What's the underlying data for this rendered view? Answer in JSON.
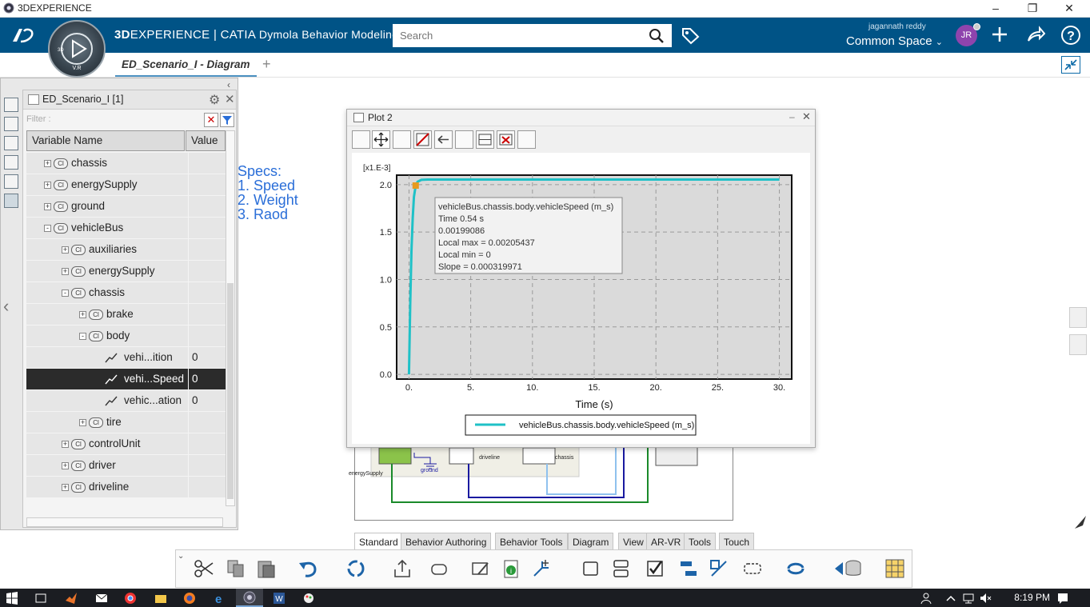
{
  "window": {
    "title": "3DEXPERIENCE"
  },
  "header": {
    "brand_bold": "3D",
    "brand_rest": "EXPERIENCE | CATIA",
    "app_name": "Dymola Behavior Modeling",
    "search_placeholder": "Search",
    "user_name": "jagannath reddy",
    "space": "Common Space",
    "avatar_initials": "JR",
    "compass_label": "V.R"
  },
  "tabs": [
    {
      "label": "ED_Scenario_I - Diagram"
    }
  ],
  "tab_add": "+",
  "variable_browser": {
    "title": "ED_Scenario_I [1]",
    "filter_placeholder": "Filter :",
    "col_name": "Variable Name",
    "col_value": "Value",
    "rows": [
      {
        "label": "chassis",
        "type": "class",
        "expand": "+",
        "value": ""
      },
      {
        "label": "energySupply",
        "type": "class",
        "expand": "+",
        "value": ""
      },
      {
        "label": "ground",
        "type": "class",
        "expand": "+",
        "value": ""
      },
      {
        "label": "vehicleBus",
        "type": "class",
        "expand": "-",
        "value": ""
      },
      {
        "label": "auxiliaries",
        "type": "class",
        "expand": "+",
        "value": ""
      },
      {
        "label": "energySupply",
        "type": "class",
        "expand": "+",
        "value": ""
      },
      {
        "label": "chassis",
        "type": "class",
        "expand": "-",
        "value": ""
      },
      {
        "label": "brake",
        "type": "class",
        "expand": "+",
        "value": ""
      },
      {
        "label": "body",
        "type": "class",
        "expand": "-",
        "value": ""
      },
      {
        "label": "vehi...ition",
        "type": "var",
        "expand": "",
        "value": "0"
      },
      {
        "label": "vehi...Speed",
        "type": "var",
        "expand": "",
        "value": "0",
        "selected": true
      },
      {
        "label": "vehic...ation",
        "type": "var",
        "expand": "",
        "value": "0"
      },
      {
        "label": "tire",
        "type": "class",
        "expand": "+",
        "value": ""
      },
      {
        "label": "controlUnit",
        "type": "class",
        "expand": "+",
        "value": ""
      },
      {
        "label": "driver",
        "type": "class",
        "expand": "+",
        "value": ""
      },
      {
        "label": "driveline",
        "type": "class",
        "expand": "+",
        "value": ""
      }
    ]
  },
  "diagram_notes": {
    "line1": "Specs:",
    "line2": "1. Speed",
    "line3": "2. Weight",
    "line4": "3. Raod"
  },
  "diagram_labels": {
    "energy": "energySupply",
    "ground": "ground",
    "driveline": "driveline",
    "chassis": "chassis"
  },
  "plot_window": {
    "title": "Plot 2",
    "minimize": "–",
    "close": "✕"
  },
  "chart_data": {
    "type": "line",
    "title": "",
    "xlabel": "Time (s)",
    "ylabel": "",
    "scale_label": "[x1.E-3]",
    "xlim": [
      -1,
      31
    ],
    "ylim": [
      -0.05,
      2.1
    ],
    "xticks": [
      "0.",
      "5.",
      "10.",
      "15.",
      "20.",
      "25.",
      "30."
    ],
    "yticks": [
      "0.0",
      "0.5",
      "1.0",
      "1.5",
      "2.0"
    ],
    "grid": true,
    "legend_position": "bottom",
    "series": [
      {
        "name": "vehicleBus.chassis.body.vehicleSpeed (m_s)",
        "color": "#1fc1c7",
        "x": [
          0,
          0.1,
          0.2,
          0.3,
          0.4,
          0.54,
          0.7,
          1.0,
          1.5,
          2,
          5,
          10,
          15,
          20,
          25,
          30
        ],
        "y": [
          0,
          0.75,
          1.3,
          1.65,
          1.87,
          1.99,
          2.03,
          2.05,
          2.054,
          2.054,
          2.054,
          2.054,
          2.054,
          2.054,
          2.054,
          2.054
        ]
      }
    ],
    "tooltip": {
      "line1": "vehicleBus.chassis.body.vehicleSpeed (m_s)",
      "line2": "Time 0.54  s",
      "line3": "0.00199086",
      "line4": "Local max = 0.00205437",
      "line5": "Local min = 0",
      "line6": "Slope = 0.000319971",
      "point_x": 0.54,
      "point_y": 1.99
    }
  },
  "command_tabs": [
    {
      "label": "Standard",
      "active": true
    },
    {
      "label": "Behavior Authoring"
    },
    {
      "label": "Behavior Tools"
    },
    {
      "label": "Diagram"
    },
    {
      "label": "View"
    },
    {
      "label": "AR-VR"
    },
    {
      "label": "Tools"
    },
    {
      "label": "Touch"
    }
  ],
  "taskbar": {
    "time": "8:19 PM"
  },
  "colors": {
    "header_bg": "#005386",
    "series": "#1fc1c7",
    "accent_blue": "#2a6ed8",
    "avatar": "#8e44ad"
  }
}
